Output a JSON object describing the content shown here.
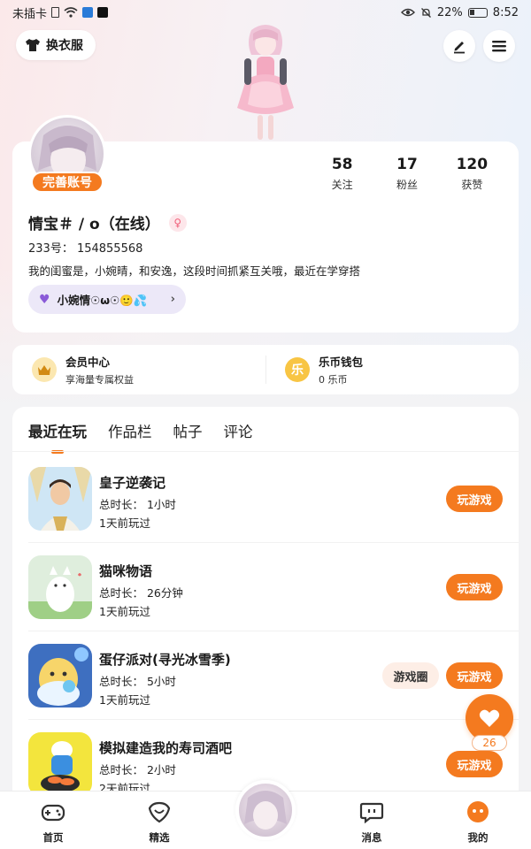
{
  "status_bar": {
    "carrier": "未插卡",
    "battery": "22%",
    "time": "8:52"
  },
  "header": {
    "outfit_label": "换衣服"
  },
  "profile": {
    "complete_badge": "完善账号",
    "stats": [
      {
        "num": "58",
        "label": "关注"
      },
      {
        "num": "17",
        "label": "粉丝"
      },
      {
        "num": "120",
        "label": "获赞"
      }
    ],
    "username": "情宝＃ / o（在线）",
    "uid": "233号：  154855568",
    "bio": "我的闺蜜是，小婉晴，和安逸，这段时间抓紧互关哦，最近在学穿搭",
    "bestie": "小婉情☉ω☉🙂💦"
  },
  "member": {
    "title": "会员中心",
    "sub": "享海量专属权益"
  },
  "wallet": {
    "title": "乐币钱包",
    "sub": "0 乐币",
    "icon_char": "乐"
  },
  "tabs": [
    {
      "label": "最近在玩"
    },
    {
      "label": "作品栏"
    },
    {
      "label": "帖子"
    },
    {
      "label": "评论"
    }
  ],
  "games": [
    {
      "name": "皇子逆袭记",
      "duration": "总时长：  1小时",
      "last": "1天前玩过",
      "play": "玩游戏"
    },
    {
      "name": "猫咪物语",
      "duration": "总时长：  26分钟",
      "last": "1天前玩过",
      "play": "玩游戏"
    },
    {
      "name": "蛋仔派对(寻光冰雪季)",
      "duration": "总时长：  5小时",
      "last": "1天前玩过",
      "play": "玩游戏",
      "circle": "游戏圈"
    },
    {
      "name": "模拟建造我的寿司酒吧",
      "duration": "总时长：  2小时",
      "last": "2天前玩过",
      "play": "玩游戏"
    }
  ],
  "like": {
    "count": "26"
  },
  "nav": [
    {
      "label": "首页",
      "icon": "gamepad-icon"
    },
    {
      "label": "精选",
      "icon": "heart-shield-icon"
    },
    {
      "label": "消息",
      "icon": "chat-icon"
    },
    {
      "label": "我的",
      "icon": "profile-face-icon"
    }
  ],
  "colors": {
    "accent": "#f47a1f",
    "bestie_bg": "#ece8f8"
  }
}
